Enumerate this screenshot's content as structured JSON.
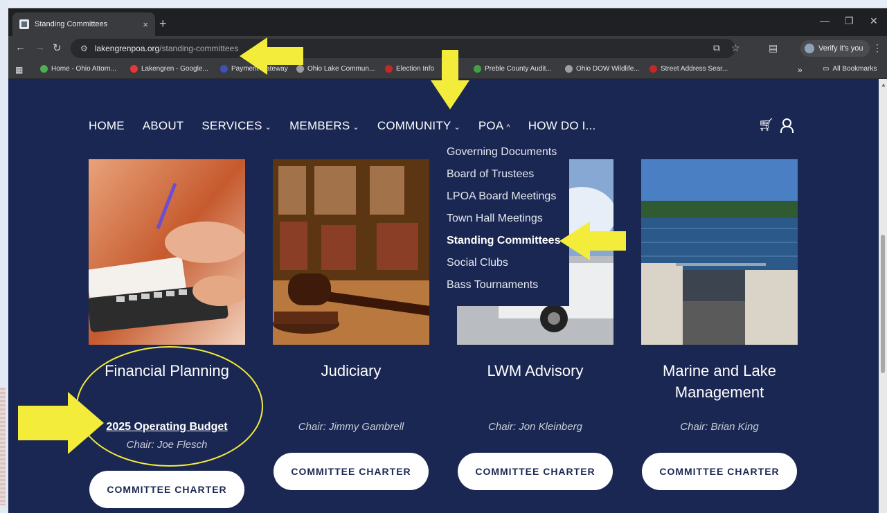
{
  "browser": {
    "tab_title": "Standing Committees",
    "tab_close": "×",
    "new_tab": "+",
    "url_host": "lakengrenpoa.org",
    "url_path": "/standing-committees",
    "verify_label": "Verify it's you",
    "bookmarks": [
      {
        "label": "Home - Ohio Attorn...",
        "color": "#4caf50"
      },
      {
        "label": "Lakengren - Google...",
        "color": "#e53935"
      },
      {
        "label": "Payment Gateway",
        "color": "#3f51b5"
      },
      {
        "label": "Ohio Lake Commun...",
        "color": "#9e9e9e"
      },
      {
        "label": "Election Info",
        "color": "#c62828"
      },
      {
        "label": "Preble County Audit...",
        "color": "#43a047"
      },
      {
        "label": "Ohio DOW Wildlife...",
        "color": "#9e9e9e"
      },
      {
        "label": "Street Address Sear...",
        "color": "#c62828"
      }
    ],
    "bookmarks_more": "»",
    "all_bookmarks": "All Bookmarks"
  },
  "nav": {
    "home": "HOME",
    "about": "ABOUT",
    "services": "SERVICES",
    "members": "MEMBERS",
    "community": "COMMUNITY",
    "poa": "POA",
    "how": "HOW DO I...",
    "chev_down": "⌄",
    "chev_up": "^"
  },
  "dropdown": {
    "items": [
      "Governing Documents",
      "Board of Trustees",
      "LPOA Board Meetings",
      "Town Hall Meetings",
      "Standing Committees",
      "Social Clubs",
      "Bass Tournaments"
    ]
  },
  "cards": [
    {
      "title": "Financial Planning",
      "link": "2025 Operating Budget ",
      "chair": "Chair: Joe Flesch",
      "button": "COMMITTEE CHARTER"
    },
    {
      "title": "Judiciary",
      "chair": "Chair: Jimmy Gambrell",
      "button": "COMMITTEE CHARTER"
    },
    {
      "title": "LWM Advisory",
      "chair": "Chair: Jon Kleinberg",
      "button": "COMMITTEE CHARTER"
    },
    {
      "title": "Marine and Lake Management",
      "chair": "Chair: Brian King",
      "button": "COMMITTEE CHARTER"
    }
  ],
  "colors": {
    "page_bg": "#1a2752",
    "annotation_yellow": "#f4ec3a"
  }
}
